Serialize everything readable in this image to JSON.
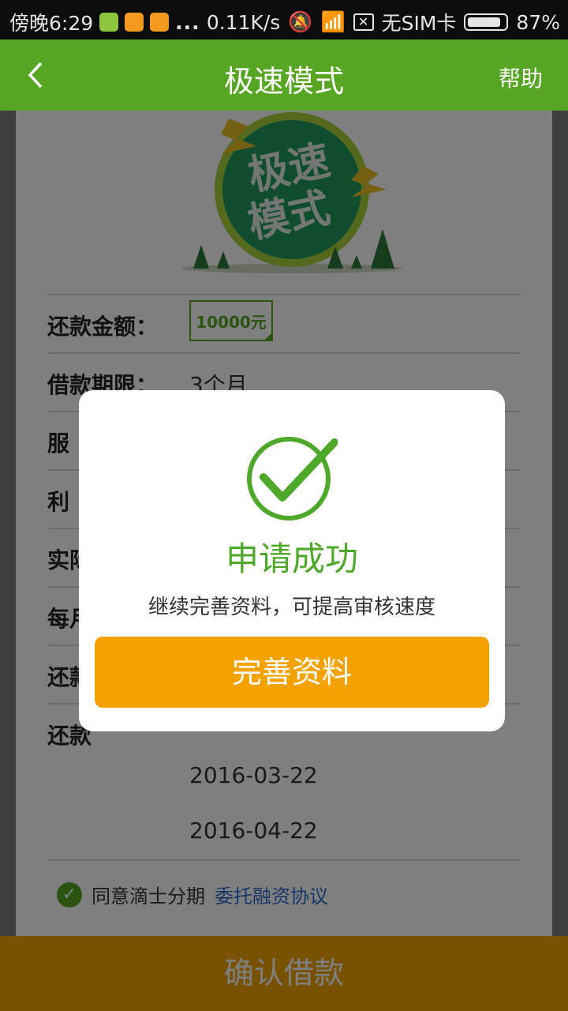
{
  "status_bar": {
    "time": "傍晚6:29",
    "dots": "...",
    "speed": "0.11K/s",
    "sim": "无SIM卡",
    "battery": "87%"
  },
  "header": {
    "back_label": "<",
    "title": "极速模式",
    "help_label": "帮助"
  },
  "hero": {
    "line1": "极速",
    "line2": "模式"
  },
  "form": {
    "rows": [
      {
        "label": "还款金额：",
        "value": "10000元"
      },
      {
        "label": "借款期限：",
        "value": "3个月"
      },
      {
        "label": "服",
        "value": ""
      },
      {
        "label": "利",
        "value": ""
      },
      {
        "label": "实际",
        "value": ""
      },
      {
        "label": "每月",
        "value": ""
      },
      {
        "label": "还款",
        "value": ""
      },
      {
        "label": "还款",
        "value": ""
      }
    ],
    "dates": [
      "2016-03-22",
      "2016-04-22"
    ]
  },
  "agreement": {
    "text": "同意滴士分期",
    "link": "委托融资协议"
  },
  "bottom_button": "确认借款",
  "dialog": {
    "title": "申请成功",
    "subtitle": "继续完善资料，可提高审核速度",
    "button": "完善资料"
  },
  "colors": {
    "brand_green": "#57a623",
    "accent_orange": "#f4a200",
    "link_blue": "#2b6fd1"
  }
}
